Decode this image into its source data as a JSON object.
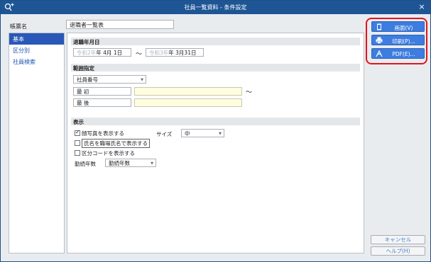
{
  "window": {
    "title": "社員一覧資料 - 条件設定",
    "app_icon": "search-plus-icon",
    "close_glyph": "×"
  },
  "form": {
    "label": "帳票名",
    "value": "退職者一覧表"
  },
  "sidebar": {
    "items": [
      {
        "label": "基本",
        "active": true
      },
      {
        "label": "区分別",
        "active": false
      },
      {
        "label": "社員検索",
        "active": false
      }
    ]
  },
  "retirement_date": {
    "heading": "退職年月日",
    "from_era": "令和2年",
    "from_rest": "年  4月  1日",
    "tilde": "～",
    "to_era": "令和3年",
    "to_rest": "年  3月31日"
  },
  "range": {
    "heading": "範囲指定",
    "key_select": "社員番号",
    "first_label": "最 初",
    "last_label": "最 後",
    "first_value": "",
    "last_value": "",
    "tilde": "～"
  },
  "display": {
    "heading": "表示",
    "show_photo": {
      "label": "顔写真を表示する",
      "checked": true
    },
    "show_name_title": {
      "label": "氏名を職場氏名で表示する",
      "checked": false
    },
    "show_category_code": {
      "label": "区分コードを表示する",
      "checked": false
    },
    "size_label": "サイズ",
    "size_value": "中",
    "years_label": "勤続年数",
    "years_value": "勤続年数"
  },
  "actions": {
    "screen": "画面(V)",
    "print": "印刷(P)...",
    "pdf": "PDF(E)...",
    "cancel": "キャンセル",
    "help": "ヘルプ(H)"
  },
  "colors": {
    "titlebar": "#1e5695",
    "accent_button": "#3d7de0",
    "highlight_ring": "#e3141c",
    "sidebar_active": "#2a58b8"
  }
}
